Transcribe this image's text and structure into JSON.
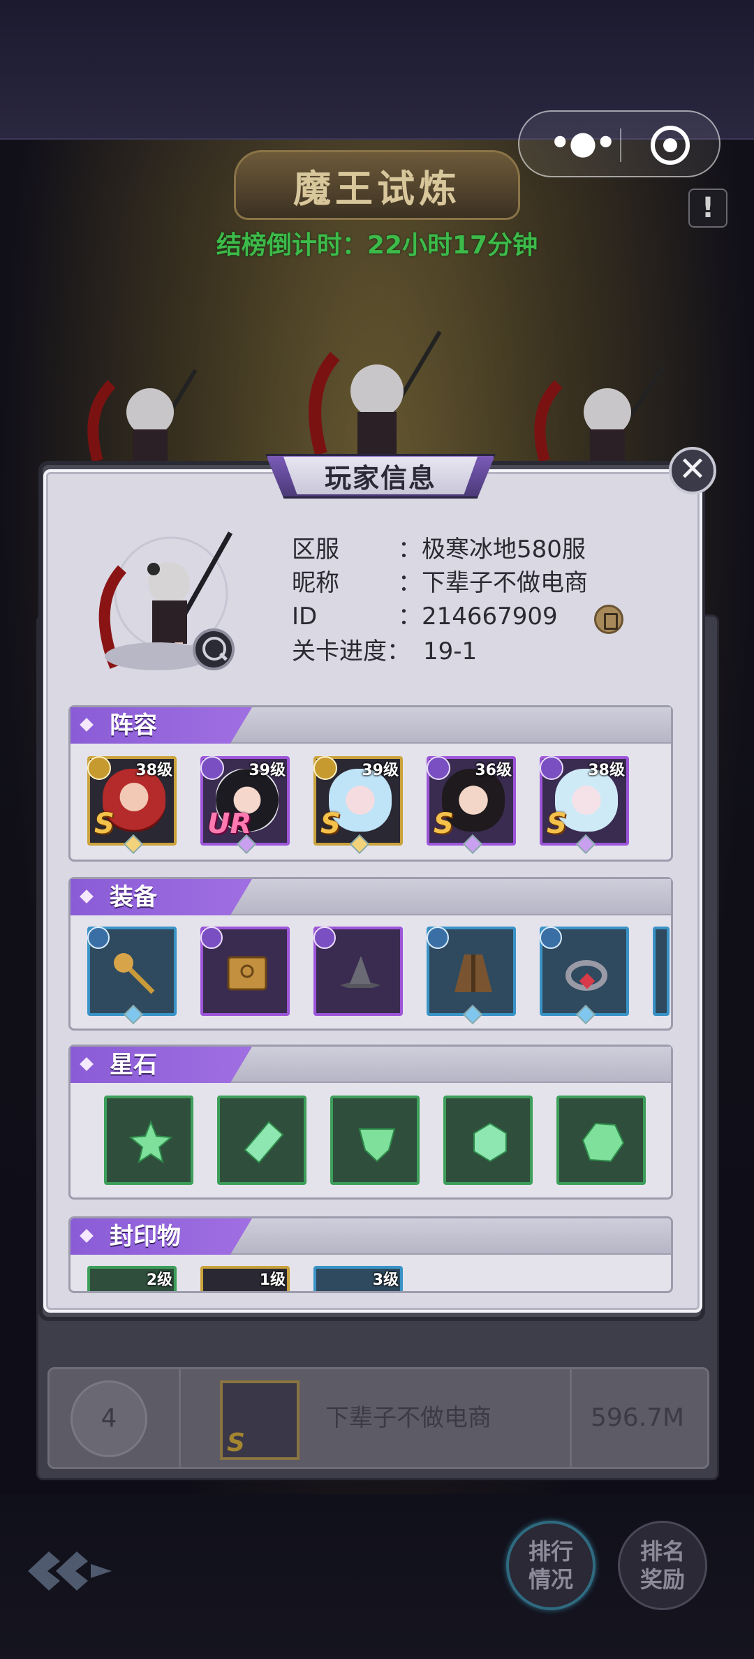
{
  "header": {
    "title": "魔王试炼",
    "countdown": "结榜倒计时：22小时17分钟",
    "info_icon": "exclamation-icon"
  },
  "capsule": {
    "more_icon": "more-dots-icon",
    "close_icon": "target-icon"
  },
  "popup": {
    "title": "玩家信息",
    "close_icon": "close-icon",
    "fields": [
      {
        "label": "区服",
        "value": "：极寒冰地580服"
      },
      {
        "label": "昵称",
        "value": "：下辈子不做电商"
      },
      {
        "label": "ID",
        "value": "：214667909"
      },
      {
        "label": "关卡进度：",
        "value": "19-1"
      }
    ],
    "sections": {
      "lineup": {
        "title": "阵容",
        "heroes": [
          {
            "level": "38级",
            "rank": "S",
            "frame": "gold"
          },
          {
            "level": "39级",
            "rank": "UR",
            "frame": "purple"
          },
          {
            "level": "39级",
            "rank": "S",
            "frame": "gold"
          },
          {
            "level": "36级",
            "rank": "S",
            "frame": "purple"
          },
          {
            "level": "38级",
            "rank": "S",
            "frame": "purple"
          }
        ]
      },
      "equipment": {
        "title": "装备",
        "items": [
          {
            "name": "staff-icon",
            "frame": "blue"
          },
          {
            "name": "book-icon",
            "frame": "purple"
          },
          {
            "name": "wizard-hat-icon",
            "frame": "purple"
          },
          {
            "name": "cloak-icon",
            "frame": "blue"
          },
          {
            "name": "bracelet-icon",
            "frame": "blue"
          }
        ]
      },
      "starstones": {
        "title": "星石",
        "items": [
          "star-gem-icon",
          "crystal-gem-icon",
          "shield-gem-icon",
          "round-gem-icon",
          "hex-gem-icon"
        ]
      },
      "seals": {
        "title": "封印物",
        "items": [
          {
            "level": "2级",
            "frame": "green"
          },
          {
            "level": "1级",
            "frame": "gold"
          },
          {
            "level": "3级",
            "frame": "blue"
          }
        ]
      }
    }
  },
  "rank_row": {
    "rank": "4",
    "name": "下辈子不做电商",
    "power": "596.7M",
    "badge": "S"
  },
  "bottom": {
    "ranking_btn": "排行\n情况",
    "ranking_line1": "排行",
    "ranking_line2": "情况",
    "reward_line1": "排名",
    "reward_line2": "奖励",
    "logo_icon": "arrow-logo-icon"
  },
  "colors": {
    "accent_purple": "#8a5cd6",
    "countdown_green": "#3dbb4a",
    "gold_frame": "#caa23c"
  }
}
